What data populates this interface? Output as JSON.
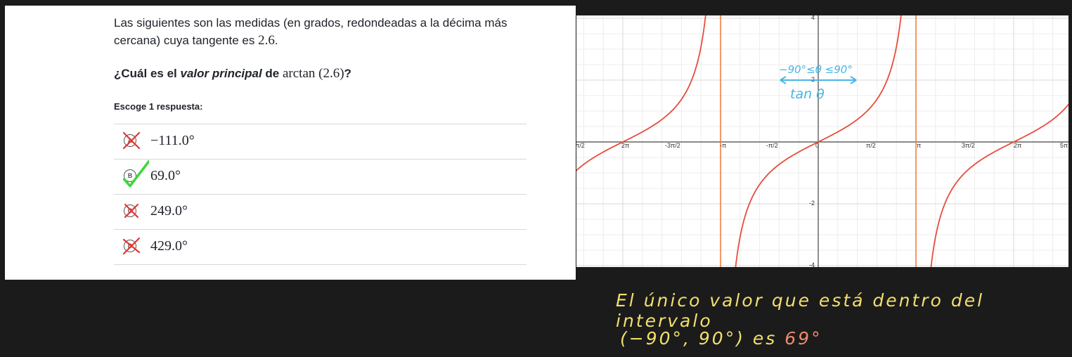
{
  "question": {
    "prompt_text": "Las siguientes son las medidas (en grados, redondeadas a la décima más cercana) cuya tangente es ",
    "prompt_value": "2.6",
    "prompt_end": ".",
    "question_start": "¿Cuál es el ",
    "question_emph": "valor principal",
    "question_mid": " de ",
    "question_math": "arctan (2.6)",
    "question_end": "?",
    "instruction": "Escoge 1 respuesta:",
    "choices": [
      {
        "letter": "A",
        "text": "−111.0°",
        "mark": "cross"
      },
      {
        "letter": "B",
        "text": "69.0°",
        "mark": "check"
      },
      {
        "letter": "C",
        "text": "249.0°",
        "mark": "cross"
      },
      {
        "letter": "D",
        "text": "429.0°",
        "mark": "cross"
      }
    ]
  },
  "graph": {
    "x_tick_labels": [
      "π/2",
      "2π",
      "-3π/2",
      "-π",
      "-π/2",
      "0",
      "π/2",
      "π",
      "3π/2",
      "2π",
      "5π"
    ],
    "y_tick_labels": [
      "4",
      "2",
      "-2",
      "-4"
    ],
    "annotation_range": "−90°≤θ ≤90°",
    "annotation_tan": "tan θ",
    "colors": {
      "curve": "#e74c3c",
      "grid": "#d9d9d9",
      "annotation": "#4ab4e6"
    }
  },
  "notes": {
    "line1": "El único valor que está dentro del intervalo",
    "line2_start": "(−90°, 90°) es ",
    "line2_value": "69°",
    "colors": {
      "text": "#f3df6b",
      "value": "#f08a6a"
    }
  }
}
